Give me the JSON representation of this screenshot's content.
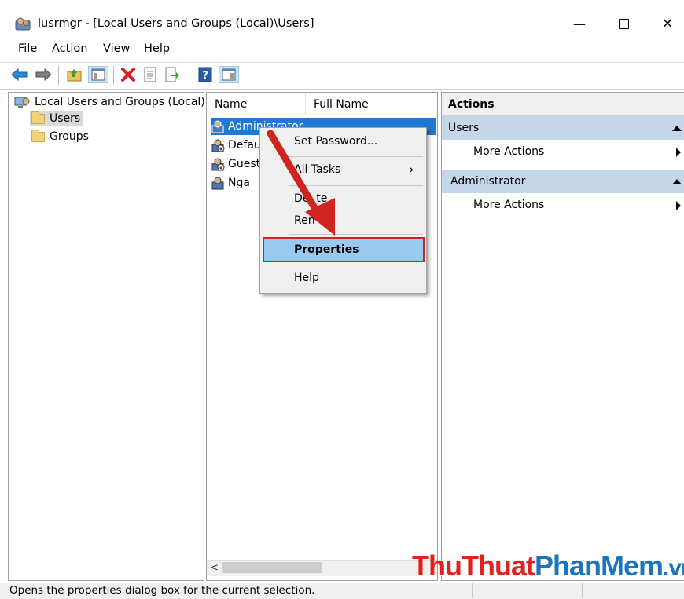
{
  "window": {
    "title": "lusrmgr - [Local Users and Groups (Local)\\Users]",
    "minimize_glyph": "—",
    "maximize_glyph": "☐",
    "close_glyph": "✕"
  },
  "menu": [
    "File",
    "Action",
    "View",
    "Help"
  ],
  "toolbar": {
    "icons": [
      "back-arrow-icon",
      "forward-arrow-icon",
      "up-folder-icon",
      "show-hide-tree-icon",
      "delete-icon",
      "properties-icon",
      "export-list-icon",
      "help-icon",
      "show-hide-action-pane-icon"
    ],
    "accent": "#1f78c8",
    "delete_color": "#d42020"
  },
  "tree": {
    "root": "Local Users and Groups (Local)",
    "children": [
      "Users",
      "Groups"
    ],
    "selected": "Users"
  },
  "list": {
    "columns": [
      "Name",
      "Full Name"
    ],
    "rows": [
      {
        "name": "Administrator",
        "selected": true
      },
      {
        "name": "Defau"
      },
      {
        "name": "Guest"
      },
      {
        "name": "Nga"
      }
    ]
  },
  "actions": {
    "title": "Actions",
    "sections": [
      {
        "header": "Users",
        "item": "More Actions"
      },
      {
        "header": "Administrator",
        "item": "More Actions"
      }
    ]
  },
  "context_menu": {
    "items": [
      "Set Password...",
      "All Tasks",
      "Delete",
      "Rename",
      "Properties",
      "Help"
    ],
    "visible_delete": "De  te",
    "visible_rename": "Ren   e",
    "submenu_arrow": "›",
    "highlighted": "Properties",
    "highlight_border": "#c0272d",
    "highlight_fill": "#99c9ef"
  },
  "status": {
    "text": "Opens the properties dialog box for the current selection."
  },
  "watermark": {
    "part1": "ThuThuat",
    "part2": "PhanMem",
    "part3": ".vn",
    "color1": "#e3201b",
    "color2": "#1b75bb"
  },
  "annotation": {
    "arrow_color": "#d0251f"
  }
}
